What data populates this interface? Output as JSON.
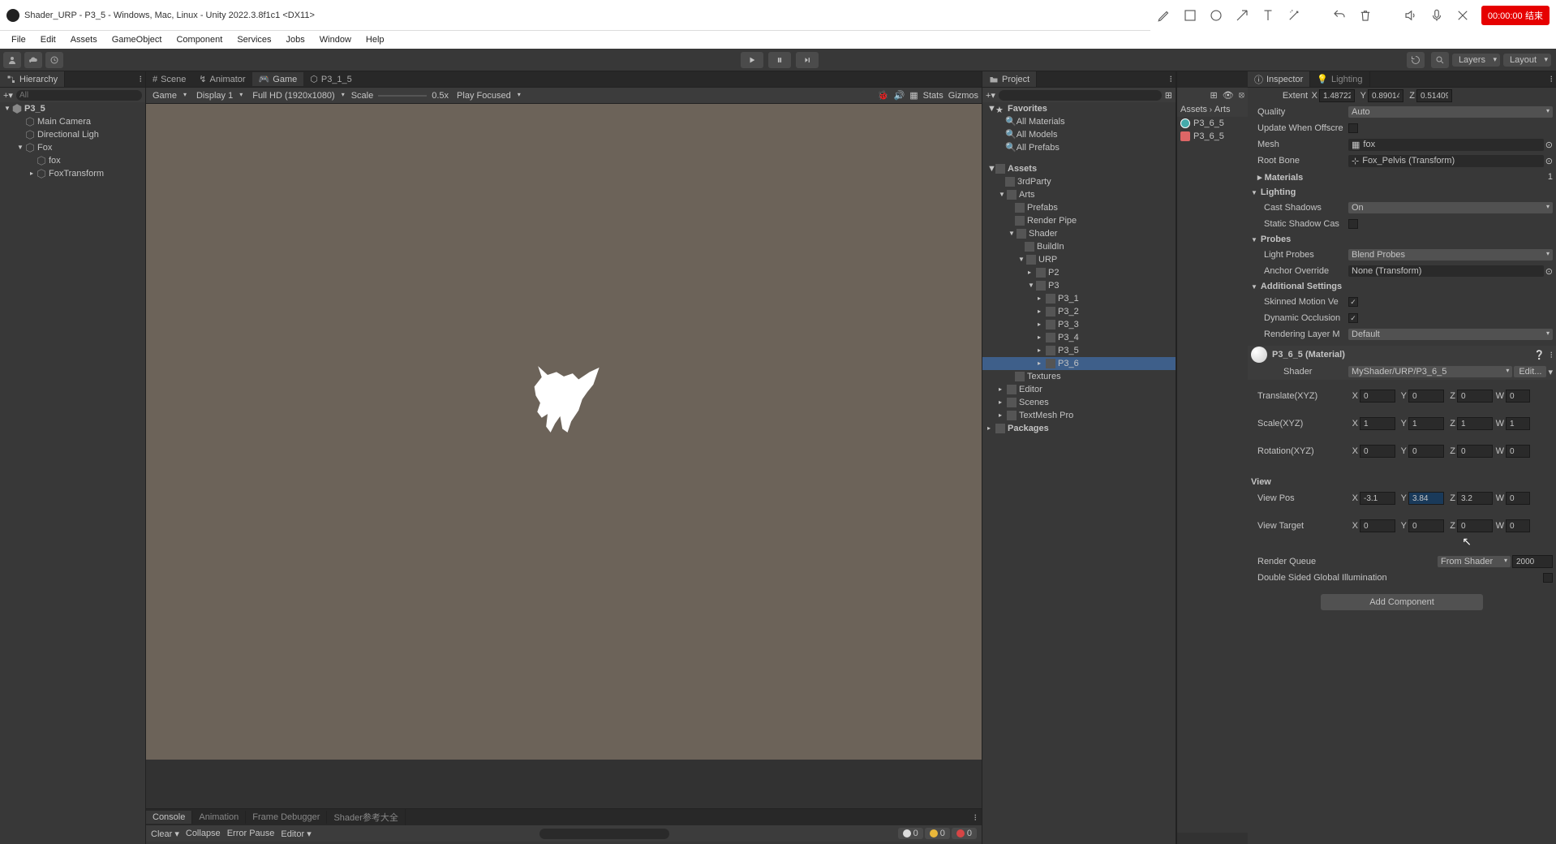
{
  "title": "Shader_URP - P3_5 - Windows, Mac, Linux - Unity 2022.3.8f1c1 <DX11>",
  "recording": {
    "time": "00:00:00",
    "end": "结束"
  },
  "menu": [
    "File",
    "Edit",
    "Assets",
    "GameObject",
    "Component",
    "Services",
    "Jobs",
    "Window",
    "Help"
  ],
  "toolbar": {
    "layers": "Layers",
    "layout": "Layout"
  },
  "hierarchy": {
    "tab": "Hierarchy",
    "search_placeholder": "All",
    "root": "P3_5",
    "items": [
      "Main Camera",
      "Directional Ligh",
      "Fox",
      "fox",
      "FoxTransform"
    ]
  },
  "scene": {
    "tabs": [
      "Scene",
      "Animator",
      "Game",
      "P3_1_5"
    ],
    "controls": {
      "mode": "Game",
      "display": "Display 1",
      "res": "Full HD (1920x1080)",
      "scale_label": "Scale",
      "scale_val": "0.5x",
      "focus": "Play Focused",
      "stats": "Stats",
      "gizmos": "Gizmos"
    }
  },
  "console": {
    "tabs": [
      "Console",
      "Animation",
      "Frame Debugger",
      "Shader参考大全"
    ],
    "buttons": {
      "clear": "Clear",
      "collapse": "Collapse",
      "error_pause": "Error Pause",
      "editor": "Editor"
    },
    "counts": {
      "info": "0",
      "warn": "0",
      "err": "0"
    }
  },
  "project": {
    "tab": "Project",
    "favorites": "Favorites",
    "fav_items": [
      "All Materials",
      "All Models",
      "All Prefabs"
    ],
    "assets": "Assets",
    "tree": [
      "3rdParty",
      "Arts",
      "Prefabs",
      "Render Pipe",
      "Shader",
      "BuildIn",
      "URP",
      "P2",
      "P3",
      "P3_1",
      "P3_2",
      "P3_3",
      "P3_4",
      "P3_5",
      "P3_6",
      "Textures",
      "Editor",
      "Scenes",
      "TextMesh Pro",
      "Packages"
    ],
    "crumb_a": "Assets",
    "crumb_b": "Arts",
    "asset_items": [
      "P3_6_5",
      "P3_6_5"
    ]
  },
  "inspector": {
    "tab": "Inspector",
    "tab2": "Lighting",
    "extent": {
      "label": "Extent",
      "x": "1.48722",
      "y": "0.89014",
      "z": "0.51409"
    },
    "quality": {
      "label": "Quality",
      "val": "Auto"
    },
    "update_off": "Update When Offscre",
    "mesh": {
      "label": "Mesh",
      "val": "fox"
    },
    "root_bone": {
      "label": "Root Bone",
      "val": "Fox_Pelvis (Transform)"
    },
    "materials": {
      "label": "Materials",
      "count": "1"
    },
    "lighting": "Lighting",
    "cast_shadows": {
      "label": "Cast Shadows",
      "val": "On"
    },
    "static_shadow": "Static Shadow Cas",
    "probes": "Probes",
    "light_probes": {
      "label": "Light Probes",
      "val": "Blend Probes"
    },
    "anchor": {
      "label": "Anchor Override",
      "val": "None (Transform)"
    },
    "additional": "Additional Settings",
    "skinned": "Skinned Motion Ve",
    "dynamic_occ": "Dynamic Occlusion",
    "render_layer": {
      "label": "Rendering Layer M",
      "val": "Default"
    },
    "material": {
      "name": "P3_6_5 (Material)",
      "shader_label": "Shader",
      "shader_val": "MyShader/URP/P3_6_5",
      "edit": "Edit...",
      "translate": {
        "label": "Translate(XYZ)",
        "x": "0",
        "y": "0",
        "z": "0",
        "w": "0"
      },
      "scale": {
        "label": "Scale(XYZ)",
        "x": "1",
        "y": "1",
        "z": "1",
        "w": "1"
      },
      "rotation": {
        "label": "Rotation(XYZ)",
        "x": "0",
        "y": "0",
        "z": "0",
        "w": "0"
      },
      "view_hdr": "View",
      "view_pos": {
        "label": "View Pos",
        "x": "-3.1",
        "y": "3.84",
        "z": "3.2",
        "w": "0"
      },
      "view_target": {
        "label": "View Target",
        "x": "0",
        "y": "0",
        "z": "0",
        "w": "0"
      },
      "render_queue": {
        "label": "Render Queue",
        "src": "From Shader",
        "val": "2000"
      },
      "dsgi": "Double Sided Global Illumination"
    },
    "add_component": "Add Component"
  }
}
